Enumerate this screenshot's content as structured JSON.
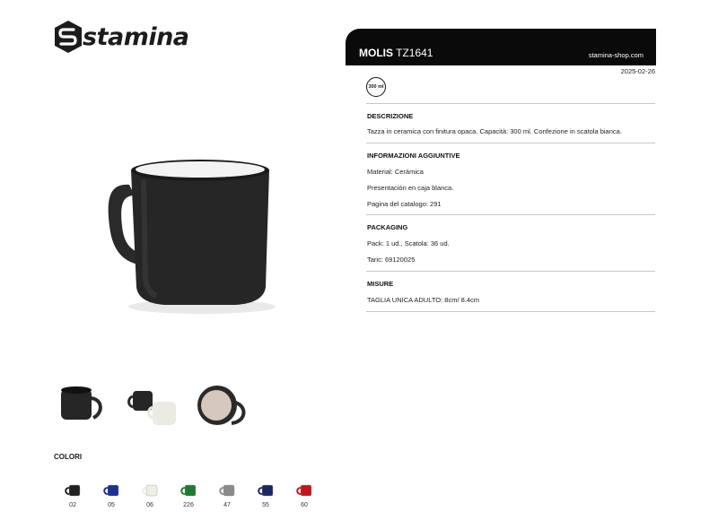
{
  "brand": {
    "name": "stamina"
  },
  "header": {
    "product_name": "MOLIS",
    "product_code": "TZ1641",
    "website": "stamina-shop.com",
    "date": "2025-02-26"
  },
  "capacity_badge": "300 ml",
  "sections": {
    "descrizione": {
      "title": "DESCRIZIONE",
      "text": "Tazza in ceramica con finitura opaca. Capacità: 300 ml. Confezione in scatola bianca."
    },
    "informazioni": {
      "title": "INFORMAZIONI AGGIUNTIVE",
      "lines": [
        "Material: Cerámica",
        "Presentación en caja blanca.",
        "Pagina del catalogo: 291"
      ]
    },
    "packaging": {
      "title": "PACKAGING",
      "lines": [
        "Pack: 1 ud., Scatola: 36 ud.",
        "Taric: 69120025"
      ]
    },
    "misure": {
      "title": "MISURE",
      "lines": [
        "TAGLIA UNICA ADULTO: 8cm/ 8.4cm"
      ]
    }
  },
  "colors": {
    "title": "COLORI",
    "items": [
      {
        "code": "02",
        "color": "#1f1f1f"
      },
      {
        "code": "05",
        "color": "#1e2f8f"
      },
      {
        "code": "06",
        "color": "#efeee6"
      },
      {
        "code": "226",
        "color": "#1f7a32"
      },
      {
        "code": "47",
        "color": "#8a8a8a"
      },
      {
        "code": "55",
        "color": "#1b2760"
      },
      {
        "code": "60",
        "color": "#c0161c"
      }
    ]
  }
}
